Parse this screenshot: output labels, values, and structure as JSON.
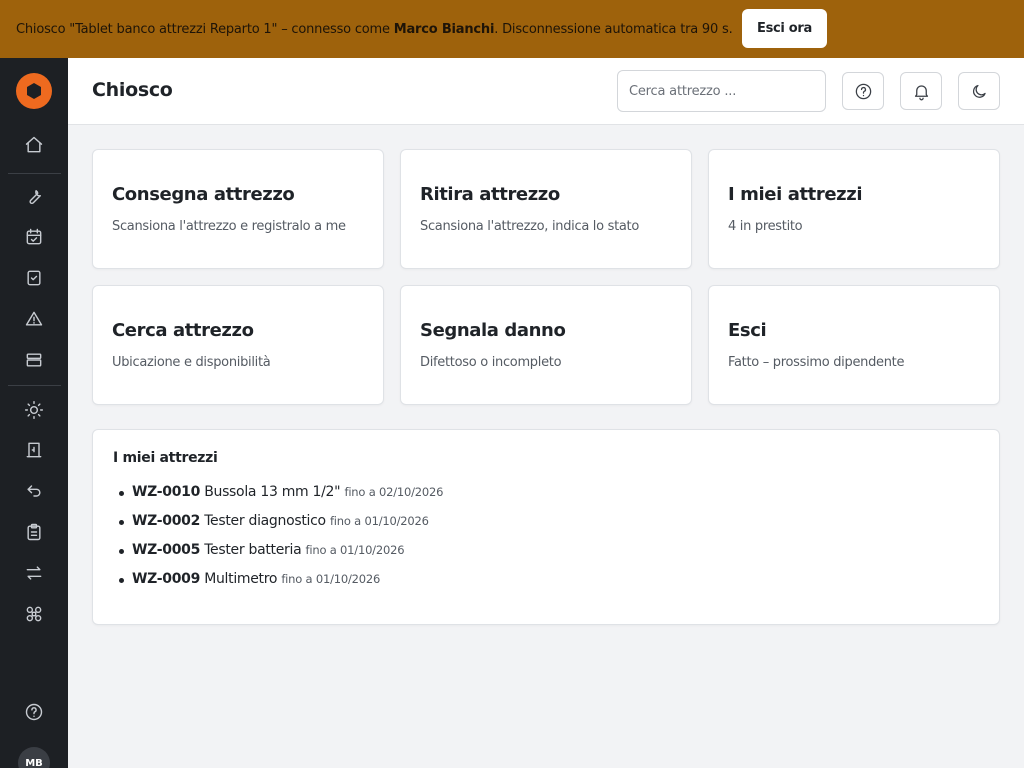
{
  "banner": {
    "prefix": "Chiosco \"Tablet banco attrezzi Reparto 1\" – connesso come ",
    "user": "Marco Bianchi",
    "suffix": ". Disconnessione automatica tra 90 s.",
    "logout_label": "Esci ora"
  },
  "sidebar": {
    "icons": [
      "home-icon",
      "wrench-icon",
      "calendar-check-icon",
      "checkbox-icon",
      "warning-icon",
      "archive-icon",
      "sun-icon",
      "receipt-icon",
      "undo-icon",
      "clipboard-icon",
      "transfer-icon",
      "command-icon",
      "help-icon"
    ],
    "avatar_initials": "MB",
    "accent_color": "#ee6a1f"
  },
  "header": {
    "title": "Chiosco",
    "search_placeholder": "Cerca attrezzo ...",
    "icons": [
      "help-icon",
      "bell-icon",
      "moon-icon"
    ]
  },
  "cards": [
    {
      "title": "Consegna attrezzo",
      "subtitle": "Scansiona l'attrezzo e registralo a me"
    },
    {
      "title": "Ritira attrezzo",
      "subtitle": "Scansiona l'attrezzo, indica lo stato"
    },
    {
      "title": "I miei attrezzi",
      "subtitle": "4 in prestito"
    },
    {
      "title": "Cerca attrezzo",
      "subtitle": "Ubicazione e disponibilità"
    },
    {
      "title": "Segnala danno",
      "subtitle": "Difettoso o incompleto"
    },
    {
      "title": "Esci",
      "subtitle": "Fatto – prossimo dipendente"
    }
  ],
  "my_tools": {
    "title": "I miei attrezzi",
    "items": [
      {
        "code": "WZ-0010",
        "name": "Bussola 13 mm 1/2\"",
        "due": "fino a 02/10/2026"
      },
      {
        "code": "WZ-0002",
        "name": "Tester diagnostico",
        "due": "fino a 01/10/2026"
      },
      {
        "code": "WZ-0005",
        "name": "Tester batteria",
        "due": "fino a 01/10/2026"
      },
      {
        "code": "WZ-0009",
        "name": "Multimetro",
        "due": "fino a 01/10/2026"
      }
    ]
  },
  "colors": {
    "banner": "#9e620c",
    "sidebar": "#1d2024",
    "background": "#f2f3f5"
  }
}
